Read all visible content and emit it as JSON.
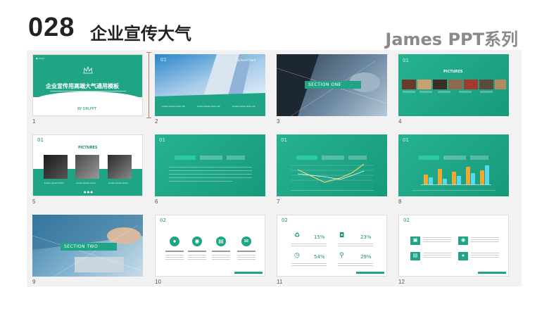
{
  "header": {
    "number": "028",
    "title": "企业宣传大气",
    "brand": "James PPT系列"
  },
  "slides": [
    {
      "num": "1",
      "title": "企业宣传用高端大气通用模板",
      "byline": "BY DRLPPT"
    },
    {
      "num": "2"
    },
    {
      "num": "3",
      "section": "SECTION ONE"
    },
    {
      "num": "4",
      "label": "PICTURES"
    },
    {
      "num": "5",
      "label": "PICTURES",
      "sec": "01"
    },
    {
      "num": "6",
      "sec": "01"
    },
    {
      "num": "7",
      "sec": "01"
    },
    {
      "num": "8",
      "sec": "01"
    },
    {
      "num": "9",
      "section": "SECTION TWO"
    },
    {
      "num": "10",
      "sec": "02"
    },
    {
      "num": "11",
      "sec": "02",
      "stats": [
        "15%",
        "23%",
        "54%",
        "29%"
      ]
    },
    {
      "num": "12",
      "sec": "02"
    }
  ],
  "colors": {
    "teal": "#1fa586",
    "teal_light": "#2dc9a1",
    "orange": "#f0a830",
    "cyan": "#59d9f0"
  },
  "icons": [
    "recycle-icon",
    "camera-icon",
    "clock-icon",
    "pin-icon",
    "bulb-icon",
    "chat-icon",
    "user-icon",
    "chart-icon"
  ]
}
